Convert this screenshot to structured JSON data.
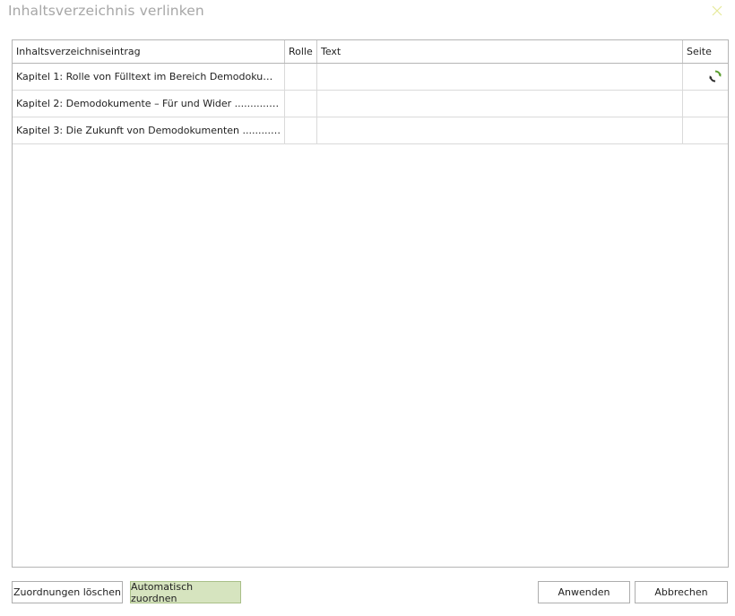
{
  "dialog": {
    "title": "Inhaltsverzeichnis verlinken",
    "close_icon": "close-icon"
  },
  "table": {
    "headers": [
      "Inhaltsverzeichniseintrag",
      "Rolle",
      "Text",
      "Seite"
    ],
    "rows": [
      {
        "entry": "Kapitel 1: Rolle von Fülltext im Bereich Demodokument…",
        "role": "",
        "text": "",
        "page": "",
        "page_icon": "refresh-icon"
      },
      {
        "entry": "Kapitel 2: Demodokumente – Für und Wider ........................",
        "role": "",
        "text": "",
        "page": ""
      },
      {
        "entry": "Kapitel 3: Die Zukunft von Demodokumenten ........................",
        "role": "",
        "text": "",
        "page": ""
      }
    ]
  },
  "buttons": {
    "clear": "Zuordnungen löschen",
    "auto": "Automatisch zuordnen",
    "apply": "Anwenden",
    "cancel": "Abbrechen"
  },
  "colors": {
    "accent_green": "#d6e4bf",
    "icon_green": "#5a9e2f"
  }
}
